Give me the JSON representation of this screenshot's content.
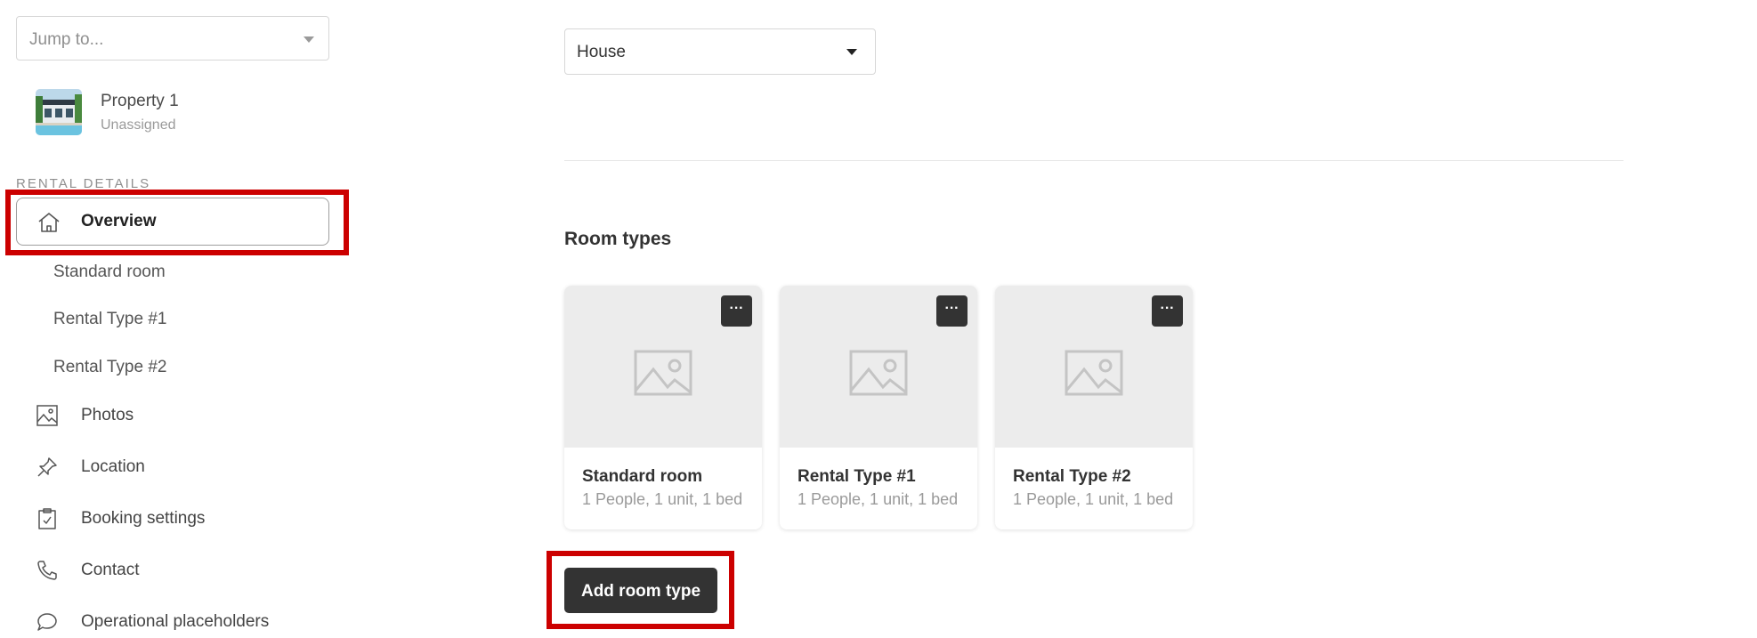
{
  "sidebar": {
    "jump_placeholder": "Jump to...",
    "property": {
      "name": "Property 1",
      "status": "Unassigned"
    },
    "section_label": "RENTAL DETAILS",
    "overview_label": "Overview",
    "sub_items": [
      "Standard room",
      "Rental Type #1",
      "Rental Type #2"
    ],
    "nav_items": [
      {
        "label": "Photos",
        "icon": "image-icon"
      },
      {
        "label": "Location",
        "icon": "pin-icon"
      },
      {
        "label": "Booking settings",
        "icon": "clipboard-check-icon"
      },
      {
        "label": "Contact",
        "icon": "phone-icon"
      },
      {
        "label": "Operational placeholders",
        "icon": "chat-bubble-icon"
      }
    ]
  },
  "main": {
    "property_type_value": "House",
    "room_types_title": "Room types",
    "room_cards": [
      {
        "title": "Standard room",
        "desc": "1 People, 1 unit, 1 bed"
      },
      {
        "title": "Rental Type #1",
        "desc": "1 People, 1 unit, 1 bed"
      },
      {
        "title": "Rental Type #2",
        "desc": "1 People, 1 unit, 1 bed"
      }
    ],
    "more_label": "···",
    "add_room_type_label": "Add room type"
  },
  "colors": {
    "highlight_box": "#cc0000",
    "button_dark": "#333333",
    "card_image_bg": "#ececec"
  }
}
